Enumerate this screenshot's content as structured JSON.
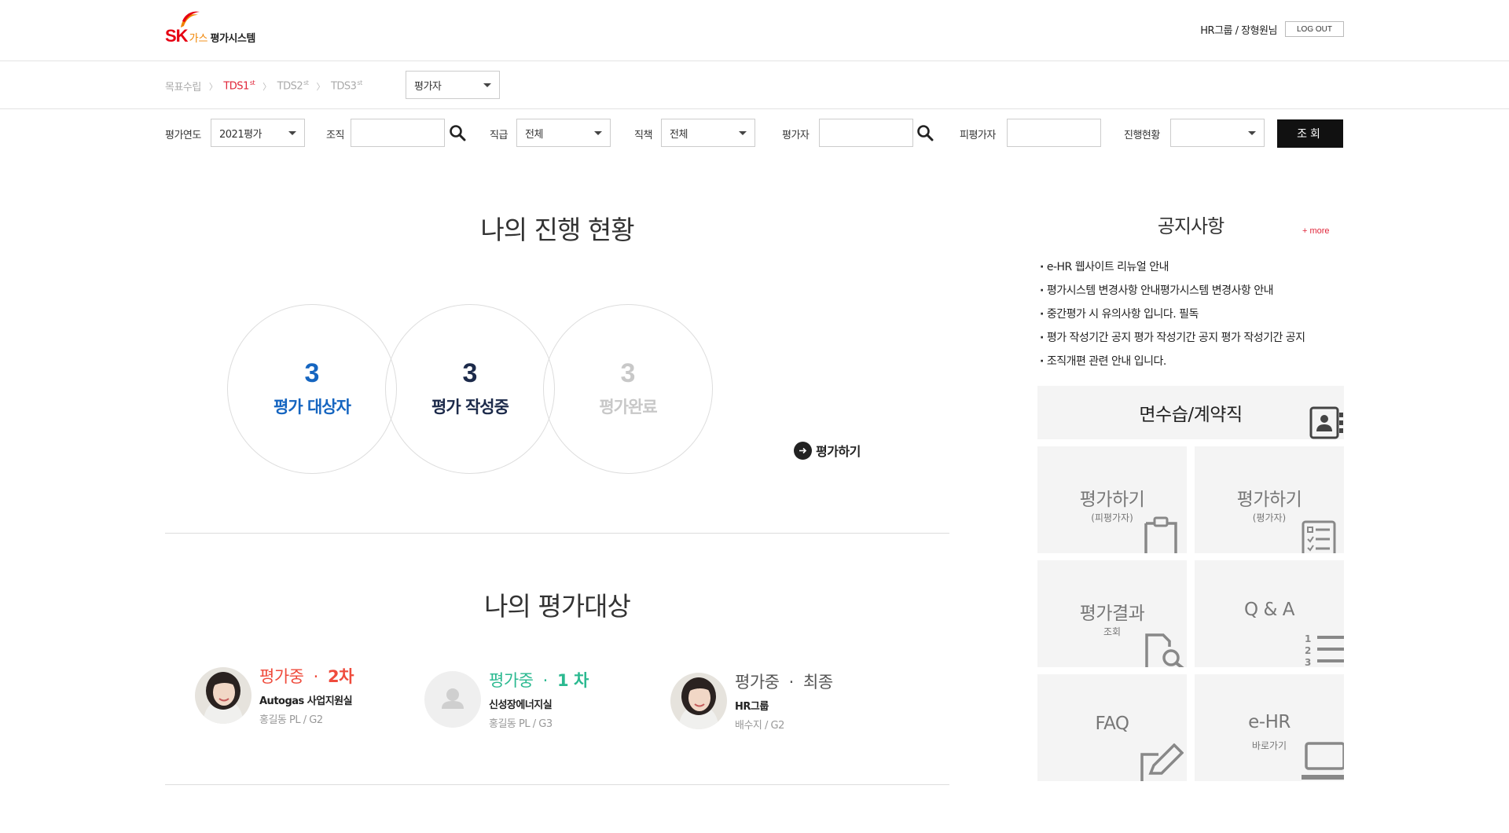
{
  "header": {
    "logo_brand": "SK",
    "logo_gas": "가스",
    "logo_system": "평가시스템",
    "user": "HR그룹 / 장형원님",
    "logout_label": "LOG OUT",
    "brand_color": "#e60012"
  },
  "stages": {
    "items": [
      {
        "label": "목표수립",
        "sup": ""
      },
      {
        "label": "TDS1",
        "sup": "st"
      },
      {
        "label": "TDS2",
        "sup": "st"
      },
      {
        "label": "TDS3",
        "sup": "st"
      }
    ],
    "active_color": "#e0263a",
    "role_select": "평가자"
  },
  "filters": {
    "year_label": "평가연도",
    "year_value": "2021평가",
    "org_label": "조직",
    "org_value": "",
    "grade_label": "직급",
    "grade_value": "전체",
    "duty_label": "직책",
    "duty_value": "전체",
    "evaluator_label": "평가자",
    "evaluator_value": "",
    "evaluatee_label": "피평가자",
    "evaluatee_value": "",
    "status_label": "진행현황",
    "status_value": "",
    "search_button": "조회"
  },
  "progress": {
    "title": "나의 진행 현황",
    "circles": [
      {
        "count": "3",
        "label": "평가 대상자",
        "color": "#1565c0"
      },
      {
        "count": "3",
        "label": "평가 작성중",
        "color": "#1c2a4a"
      },
      {
        "count": "3",
        "label": "평가완료",
        "color": "#c8c8c8"
      }
    ],
    "go_label": "평가하기"
  },
  "targets": {
    "title": "나의 평가대상",
    "items": [
      {
        "status": "평가중",
        "sep": "·",
        "round": "2차",
        "org": "Autogas 사업지원실",
        "position": "홍길동 PL / G2",
        "color": "#ef4b3c",
        "avatar": "photo"
      },
      {
        "status": "평가중",
        "sep": "·",
        "round": "1 차",
        "org": "신성장에너지실",
        "position": "홍길동 PL / G3",
        "color": "#2bb990",
        "avatar": "placeholder"
      },
      {
        "status": "평가중",
        "sep": "·",
        "round": "최종",
        "org": "HR그룹",
        "position": "배수지 / G2",
        "color": "#555555",
        "avatar": "photo"
      }
    ]
  },
  "notice": {
    "title": "공지사항",
    "more": "+ more",
    "items": [
      "e-HR 웹사이트 리뉴얼 안내",
      "평가시스템 변경사항 안내평가시스템 변경사항 안내",
      "중간평가 시 유의사항 입니다.  필독",
      "평가 작성기간 공지 평가 작성기간 공지 평가 작성기간 공지",
      "조직개편 관련 안내 입니다."
    ]
  },
  "quick": {
    "header": "면수습/계약직",
    "tiles": [
      {
        "title": "평가하기",
        "sub": "(피평가자)",
        "icon": "clipboard-icon"
      },
      {
        "title": "평가하기",
        "sub": "(평가자)",
        "icon": "checklist-icon"
      },
      {
        "title": "평가결과",
        "sub": "조회",
        "icon": "document-search-icon"
      },
      {
        "title": "Q & A",
        "sub": "",
        "icon": "numbered-list-icon"
      },
      {
        "title": "FAQ",
        "sub": "",
        "icon": "edit-icon"
      },
      {
        "title": "e-HR",
        "sub": "바로가기",
        "icon": "laptop-icon"
      }
    ]
  }
}
